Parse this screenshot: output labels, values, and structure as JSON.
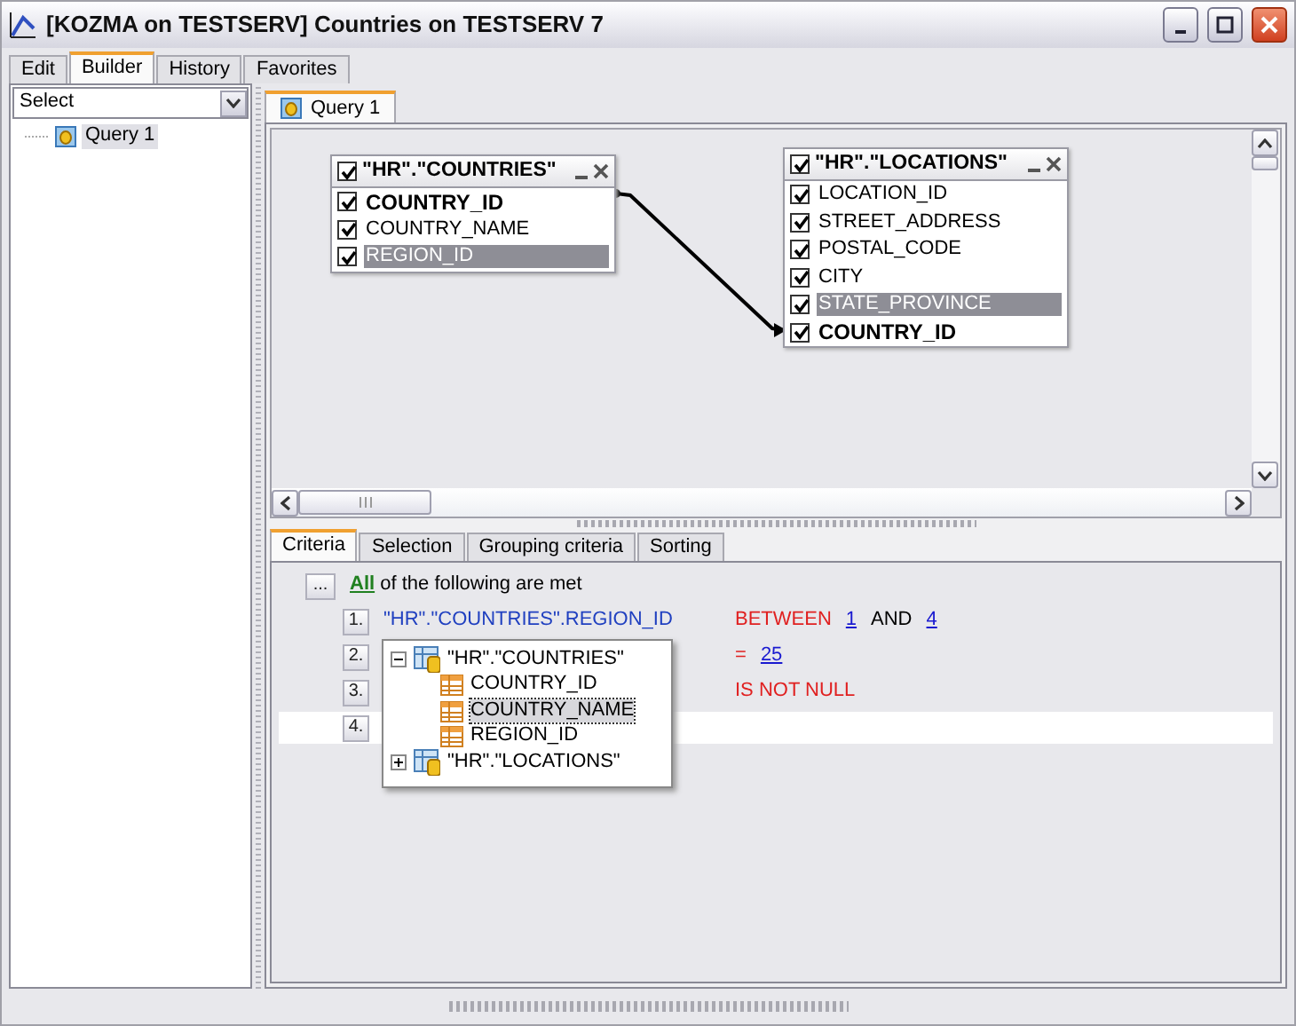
{
  "window": {
    "title": "[KOZMA on TESTSERV] Countries on TESTSERV 7"
  },
  "tabs": [
    {
      "label": "Edit",
      "selected": false
    },
    {
      "label": "Builder",
      "selected": true
    },
    {
      "label": "History",
      "selected": false
    },
    {
      "label": "Favorites",
      "selected": false
    }
  ],
  "left_panel": {
    "select": {
      "value": "Select"
    },
    "tree": [
      {
        "label": "Query 1",
        "selected": true
      }
    ]
  },
  "query_tabs": [
    {
      "label": "Query 1",
      "selected": true
    }
  ],
  "diagram": {
    "tables": [
      {
        "title": "\"HR\".\"COUNTRIES\"",
        "checked": true,
        "fields": [
          {
            "name": "COUNTRY_ID",
            "checked": true,
            "linked": true,
            "selected": false
          },
          {
            "name": "COUNTRY_NAME",
            "checked": true,
            "linked": false,
            "selected": false
          },
          {
            "name": "REGION_ID",
            "checked": true,
            "linked": false,
            "selected": true
          }
        ]
      },
      {
        "title": "\"HR\".\"LOCATIONS\"",
        "checked": true,
        "fields": [
          {
            "name": "LOCATION_ID",
            "checked": true,
            "linked": false,
            "selected": false
          },
          {
            "name": "STREET_ADDRESS",
            "checked": true,
            "linked": false,
            "selected": false
          },
          {
            "name": "POSTAL_CODE",
            "checked": true,
            "linked": false,
            "selected": false
          },
          {
            "name": "CITY",
            "checked": true,
            "linked": false,
            "selected": false
          },
          {
            "name": "STATE_PROVINCE",
            "checked": true,
            "linked": false,
            "selected": true
          },
          {
            "name": "COUNTRY_ID",
            "checked": true,
            "linked": true,
            "selected": false
          }
        ]
      }
    ]
  },
  "criteria_tabs": [
    {
      "label": "Criteria",
      "selected": true
    },
    {
      "label": "Selection",
      "selected": false
    },
    {
      "label": "Grouping criteria",
      "selected": false
    },
    {
      "label": "Sorting",
      "selected": false
    }
  ],
  "criteria": {
    "button": "...",
    "all_label": "All",
    "tail": "of the following are met",
    "rows": [
      {
        "number": "1.",
        "field": "\"HR\".\"COUNTRIES\".REGION_ID",
        "operator": "BETWEEN",
        "values": [
          {
            "kind": "link",
            "text": "1"
          },
          {
            "kind": "text",
            "text": "AND"
          },
          {
            "kind": "link",
            "text": "4"
          }
        ],
        "selected": false
      },
      {
        "number": "2.",
        "operator": "=",
        "values": [
          {
            "kind": "link",
            "text": "25"
          }
        ],
        "selected": false
      },
      {
        "number": "3.",
        "operator": "IS NOT NULL",
        "selected": false
      },
      {
        "number": "4.",
        "selected": true
      }
    ]
  },
  "popup_tree": [
    {
      "label": "\"HR\".\"COUNTRIES\"",
      "expanded": true,
      "children": [
        {
          "label": "COUNTRY_ID",
          "selected": false
        },
        {
          "label": "COUNTRY_NAME",
          "selected": true
        },
        {
          "label": "REGION_ID",
          "selected": false
        }
      ]
    },
    {
      "label": "\"HR\".\"LOCATIONS\"",
      "expanded": false
    }
  ]
}
